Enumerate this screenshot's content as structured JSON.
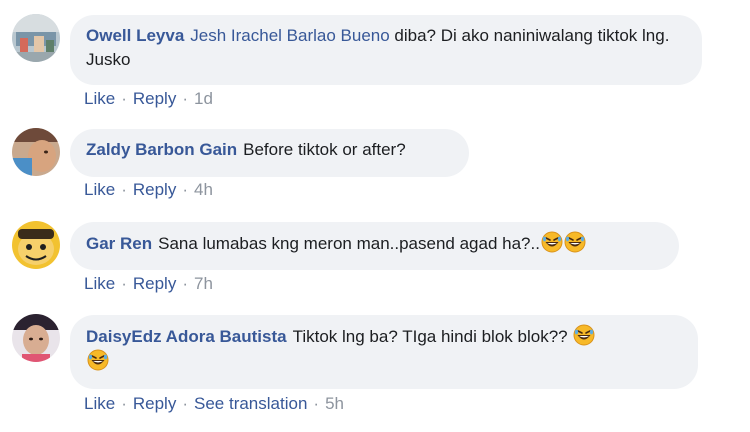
{
  "comments": [
    {
      "author": "Owell Leyva",
      "mention": "Jesh Irachel Barlao Bueno",
      "text": " diba? Di ako naniniwalang tiktok lng. Jusko",
      "like": "Like",
      "reply": "Reply",
      "time": "1d"
    },
    {
      "author": "Zaldy Barbon Gain",
      "text": "Before tiktok or after?",
      "like": "Like",
      "reply": "Reply",
      "time": "4h"
    },
    {
      "author": "Gar Ren",
      "text": "Sana lumabas kng meron man..pasend agad ha?..",
      "like": "Like",
      "reply": "Reply",
      "time": "7h"
    },
    {
      "author": "DaisyEdz Adora Bautista",
      "text": "Tiktok lng ba? TIga hindi blok blok??",
      "like": "Like",
      "reply": "Reply",
      "translate": "See translation",
      "time": "5h"
    }
  ],
  "separator": "·",
  "emoji_name": "rolling-on-floor-laughing",
  "colors": {
    "link": "#385898",
    "bubble": "#f0f2f5",
    "meta": "#8d949e",
    "emoji_face": "#f7b928"
  }
}
